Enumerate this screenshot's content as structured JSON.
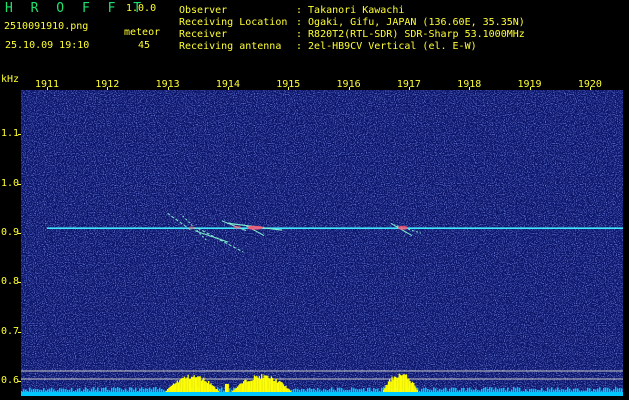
{
  "header": {
    "app_name": "H R O F F T",
    "version": "1.0.0",
    "filename": "2510091910.png",
    "detection_type": "meteor",
    "timestamp": "25.10.09 19:10",
    "count": "45",
    "fields": [
      {
        "label": "Observer",
        "value": ": Takanori Kawachi"
      },
      {
        "label": "Receiving Location",
        "value": ": Ogaki, Gifu, JAPAN (136.60E, 35.35N)"
      },
      {
        "label": "Receiver",
        "value": ": R820T2(RTL-SDR) SDR-Sharp 53.1000MHz"
      },
      {
        "label": "Receiving antenna",
        "value": ": 2el-HB9CV Vertical (el. E-W)"
      }
    ]
  },
  "chart_data": {
    "type": "heatmap",
    "ylabel": "kHz",
    "x_ticks": [
      "1911",
      "1912",
      "1913",
      "1914",
      "1915",
      "1916",
      "1917",
      "1918",
      "1919",
      "1920"
    ],
    "y_ticks": [
      "1.1",
      "1.0",
      "0.9",
      "0.8",
      "0.7",
      "0.6"
    ],
    "y_range": [
      0.57,
      1.19
    ],
    "carrier_khz": 0.91,
    "meteor_events": [
      {
        "time": "1913.3",
        "peak": "1913.4"
      },
      {
        "time": "1914.0",
        "peak": "1914.5"
      },
      {
        "time": "1916.8",
        "peak": "1916.9"
      }
    ],
    "colors": {
      "background": "#0a1468",
      "noise": "#2838c8",
      "carrier": "#40e8ff",
      "trail": "#80f0d0",
      "echo_core": "#ff5070",
      "label": "#ffff33",
      "activity_bar": "#ffff00",
      "baseline": "#00c8ff"
    }
  }
}
